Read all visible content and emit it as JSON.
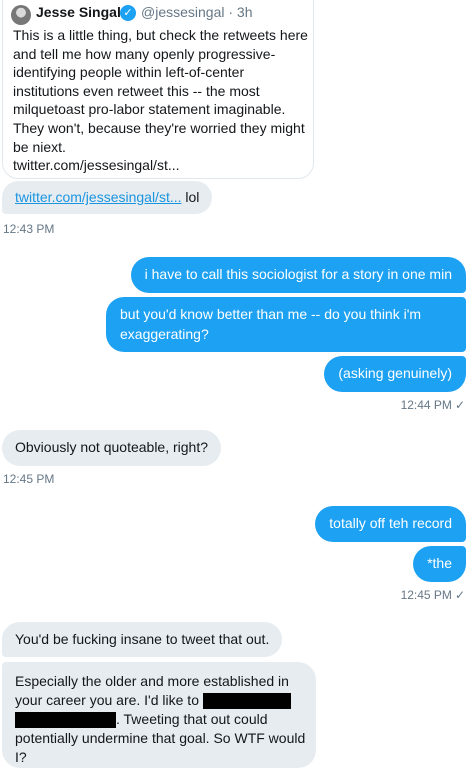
{
  "quoted_tweet": {
    "name": "Jesse Singal",
    "handle": "@jessesingal · 3h",
    "text": "This is a little thing, but check the retweets here and tell me how many openly progressive-identifying people within left-of-center institutions even retweet this -- the most milquetoast pro-labor statement imaginable. They won't, because they're worried they might be niext.\ntwitter.com/jessesingal/st..."
  },
  "messages": [
    {
      "side": "received",
      "link": "twitter.com/jessesingal/st...",
      "text": " lol",
      "timestamp": "12:43 PM"
    },
    {
      "side": "sent",
      "text": "i have to call this sociologist for a story in one min"
    },
    {
      "side": "sent",
      "text": "but you'd know better than me -- do you think i'm exaggerating?"
    },
    {
      "side": "sent",
      "text": "(asking genuinely)",
      "timestamp": "12:44 PM"
    },
    {
      "side": "received",
      "text": "Obviously not quoteable, right?",
      "timestamp": "12:45 PM"
    },
    {
      "side": "sent",
      "text": "totally off teh record"
    },
    {
      "side": "sent",
      "text": "*the",
      "timestamp": "12:45 PM"
    },
    {
      "side": "received",
      "text": "You'd be fucking insane to tweet that out."
    },
    {
      "side": "received",
      "text_parts": [
        "Especially the older and more established in your career you are. I'd like to ",
        " ",
        ". Tweeting that out could potentially undermine that goal. So WTF would I?"
      ]
    }
  ],
  "icons": {
    "verified": "verified-badge-icon",
    "read": "checkmark-icon",
    "avatar": "avatar"
  },
  "colors": {
    "sent_bubble": "#1da1f2",
    "received_bubble": "#e6ecf0",
    "link": "#1b95e0",
    "timestamp": "#657786"
  }
}
